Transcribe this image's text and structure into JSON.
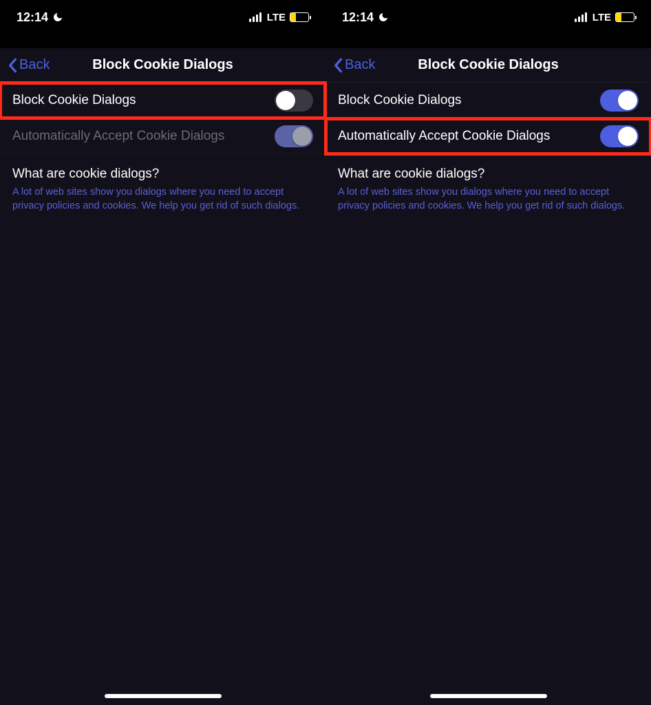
{
  "status": {
    "time": "12:14",
    "network": "LTE"
  },
  "nav": {
    "back": "Back",
    "title": "Block Cookie Dialogs"
  },
  "rows": {
    "block": "Block Cookie Dialogs",
    "auto": "Automatically Accept Cookie Dialogs"
  },
  "info": {
    "heading": "What are cookie dialogs?",
    "body": "A lot of web sites show you dialogs where you need to accept privacy policies and cookies. We help you get rid of such dialogs."
  }
}
